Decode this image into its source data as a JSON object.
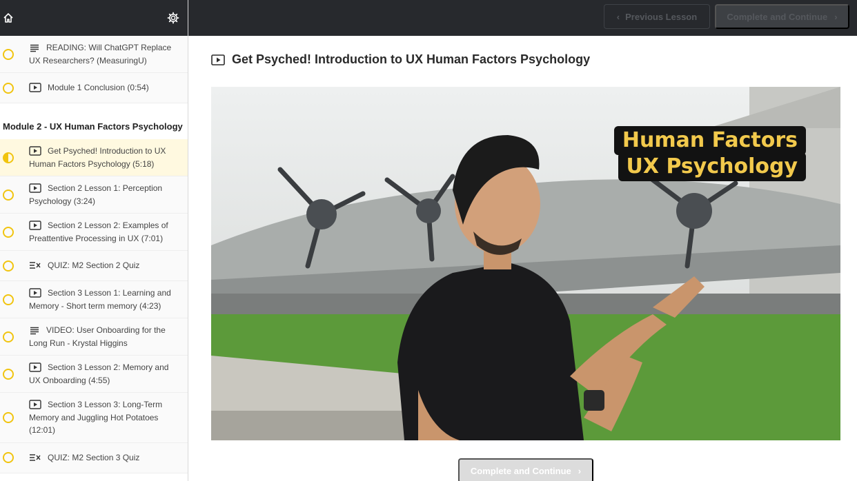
{
  "topbar": {
    "prev_label": "Previous Lesson",
    "next_label": "Complete and Continue"
  },
  "sidebar": {
    "lessons_before": [
      {
        "type": "reading",
        "text": "READING: Will ChatGPT Replace UX Researchers? (MeasuringU)",
        "status": "incomplete"
      },
      {
        "type": "video",
        "text": "Module 1 Conclusion (0:54)",
        "status": "incomplete"
      }
    ],
    "module_title": "Module 2 - UX Human Factors Psychology",
    "lessons": [
      {
        "type": "video",
        "text": "Get Psyched! Introduction to UX Human Factors Psychology (5:18)",
        "status": "in-progress"
      },
      {
        "type": "video",
        "text": "Section 2 Lesson 1: Perception Psychology (3:24)",
        "status": "incomplete"
      },
      {
        "type": "video",
        "text": "Section 2 Lesson 2: Examples of Preattentive Processing in UX (7:01)",
        "status": "incomplete"
      },
      {
        "type": "quiz",
        "text": "QUIZ: M2 Section 2 Quiz",
        "status": "incomplete"
      },
      {
        "type": "video",
        "text": "Section 3 Lesson 1: Learning and Memory - Short term memory (4:23)",
        "status": "incomplete"
      },
      {
        "type": "reading",
        "text": "VIDEO: User Onboarding for the Long Run - Krystal Higgins",
        "status": "incomplete"
      },
      {
        "type": "video",
        "text": "Section 3 Lesson 2: Memory and UX Onboarding (4:55)",
        "status": "incomplete"
      },
      {
        "type": "video",
        "text": "Section 3 Lesson 3: Long-Term Memory and Juggling Hot Potatoes (12:01)",
        "status": "incomplete"
      },
      {
        "type": "quiz",
        "text": "QUIZ: M2 Section 3 Quiz",
        "status": "incomplete"
      }
    ]
  },
  "main": {
    "title": "Get Psyched! Introduction to UX Human Factors Psychology",
    "video_overlay": {
      "line1": "Human Factors",
      "line2": "UX Psychology"
    },
    "complete_label": "Complete and Continue"
  },
  "colors": {
    "topbar": "#27292d",
    "status_ring": "#f1c40f",
    "active_row": "#fff9e0",
    "overlay_text": "#f2c94c"
  }
}
